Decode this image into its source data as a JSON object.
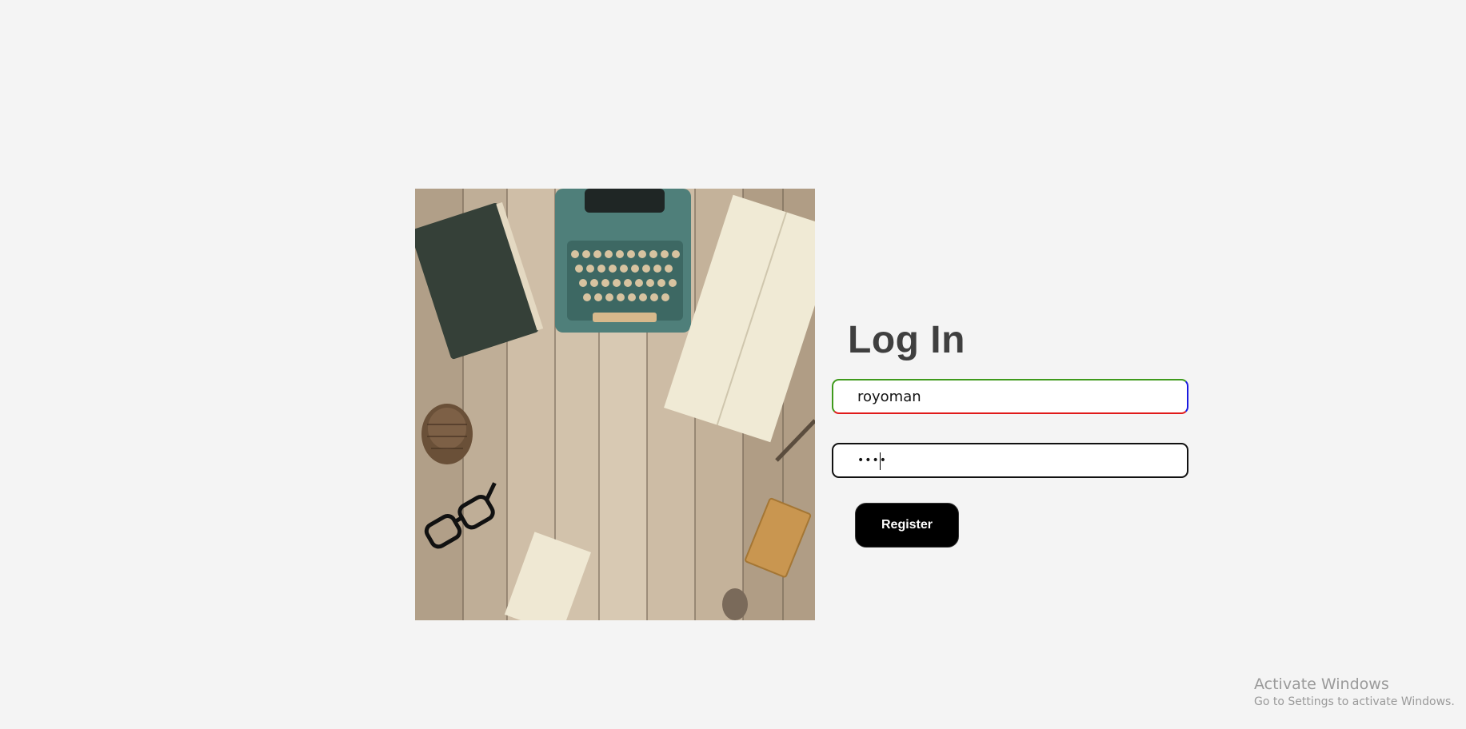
{
  "login": {
    "title": "Log In",
    "username_value": "royoman",
    "password_value": "••••",
    "register_label": "Register"
  },
  "watermark": {
    "title": "Activate Windows",
    "subtitle": "Go to Settings to activate Windows."
  },
  "hero": {
    "description_icon": "desk-photo-image"
  }
}
